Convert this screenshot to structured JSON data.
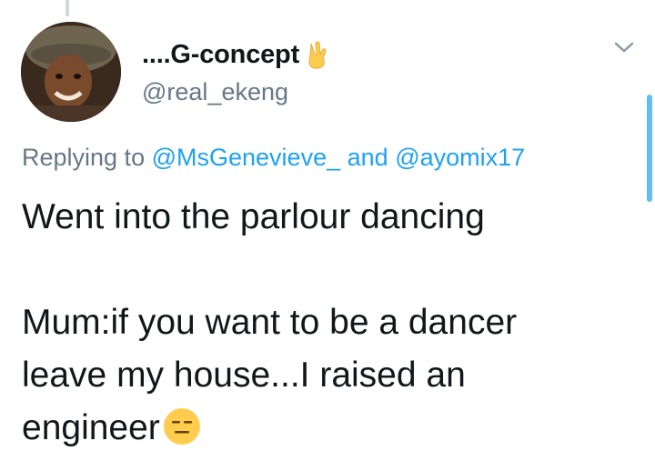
{
  "tweet": {
    "display_name": "....G-concept",
    "name_emoji": "victory-hand-emoji",
    "handle": "@real_ekeng",
    "reply": {
      "prefix": "Replying to",
      "mention_1": "@MsGenevieve_",
      "joiner": "and",
      "mention_2": "@ayomix17"
    },
    "text": {
      "line_1": "Went into the parlour dancing",
      "line_2": "Mum:if you want to be a dancer",
      "line_3": "leave my house...I raised an",
      "line_4": "engineer",
      "trailing_emoji": "expressionless-face-emoji"
    }
  },
  "colors": {
    "text": "#14171a",
    "secondary": "#657786",
    "link": "#1da1f2",
    "emoji": "#ffcc4d"
  }
}
